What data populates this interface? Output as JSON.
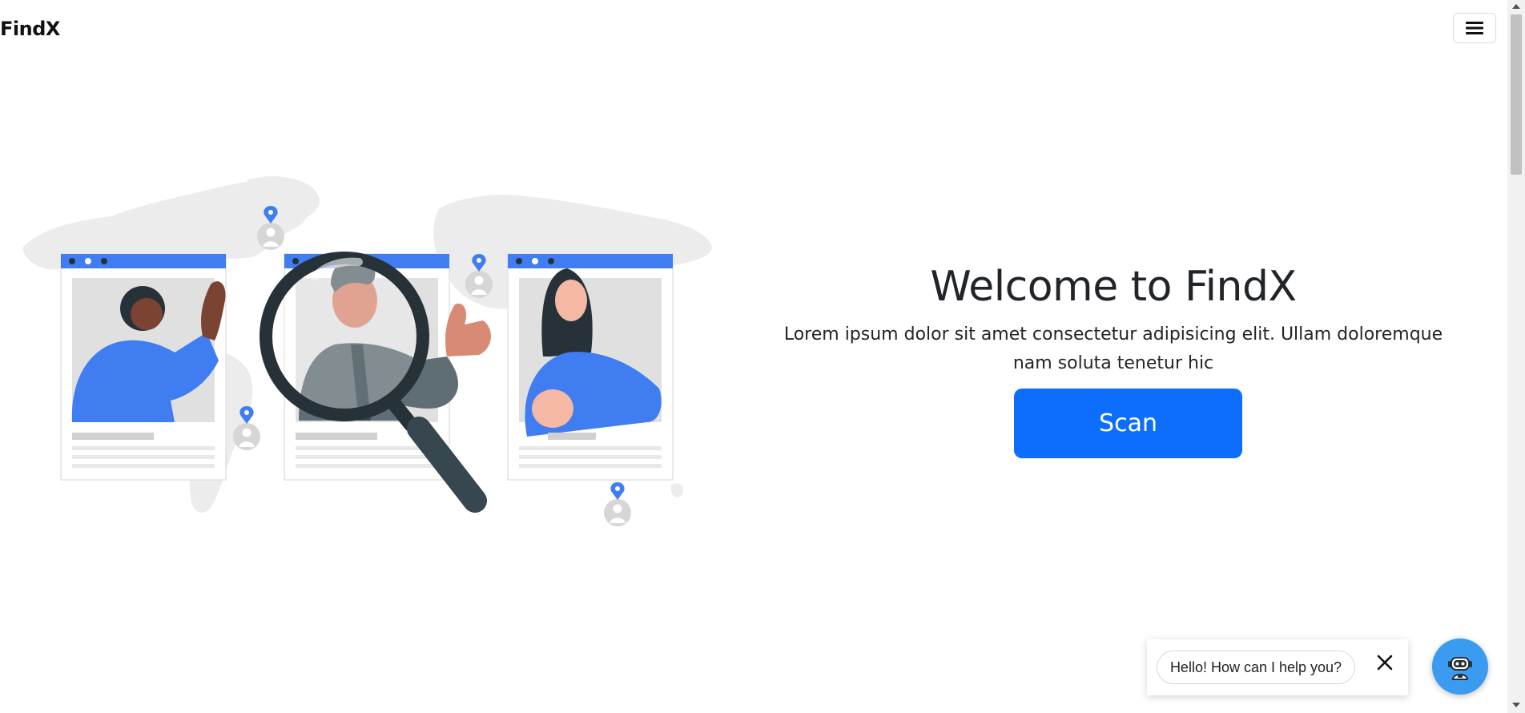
{
  "navbar": {
    "brand": "FindX",
    "menu_icon": "hamburger-menu-icon"
  },
  "hero": {
    "illustration": "people-search-map-illustration",
    "title": "Welcome to FindX",
    "lead": "Lorem ipsum dolor sit amet consectetur adipisicing elit. Ullam doloremque nam soluta tenetur hic",
    "scan_label": "Scan"
  },
  "chat": {
    "message": "Hello! How can I help you?",
    "close_icon": "close-icon",
    "bot_icon": "chatbot-robot-icon"
  },
  "colors": {
    "accent": "#0d6efd",
    "bot": "#3a9bf0",
    "illustration_blue": "#3f7df0"
  }
}
